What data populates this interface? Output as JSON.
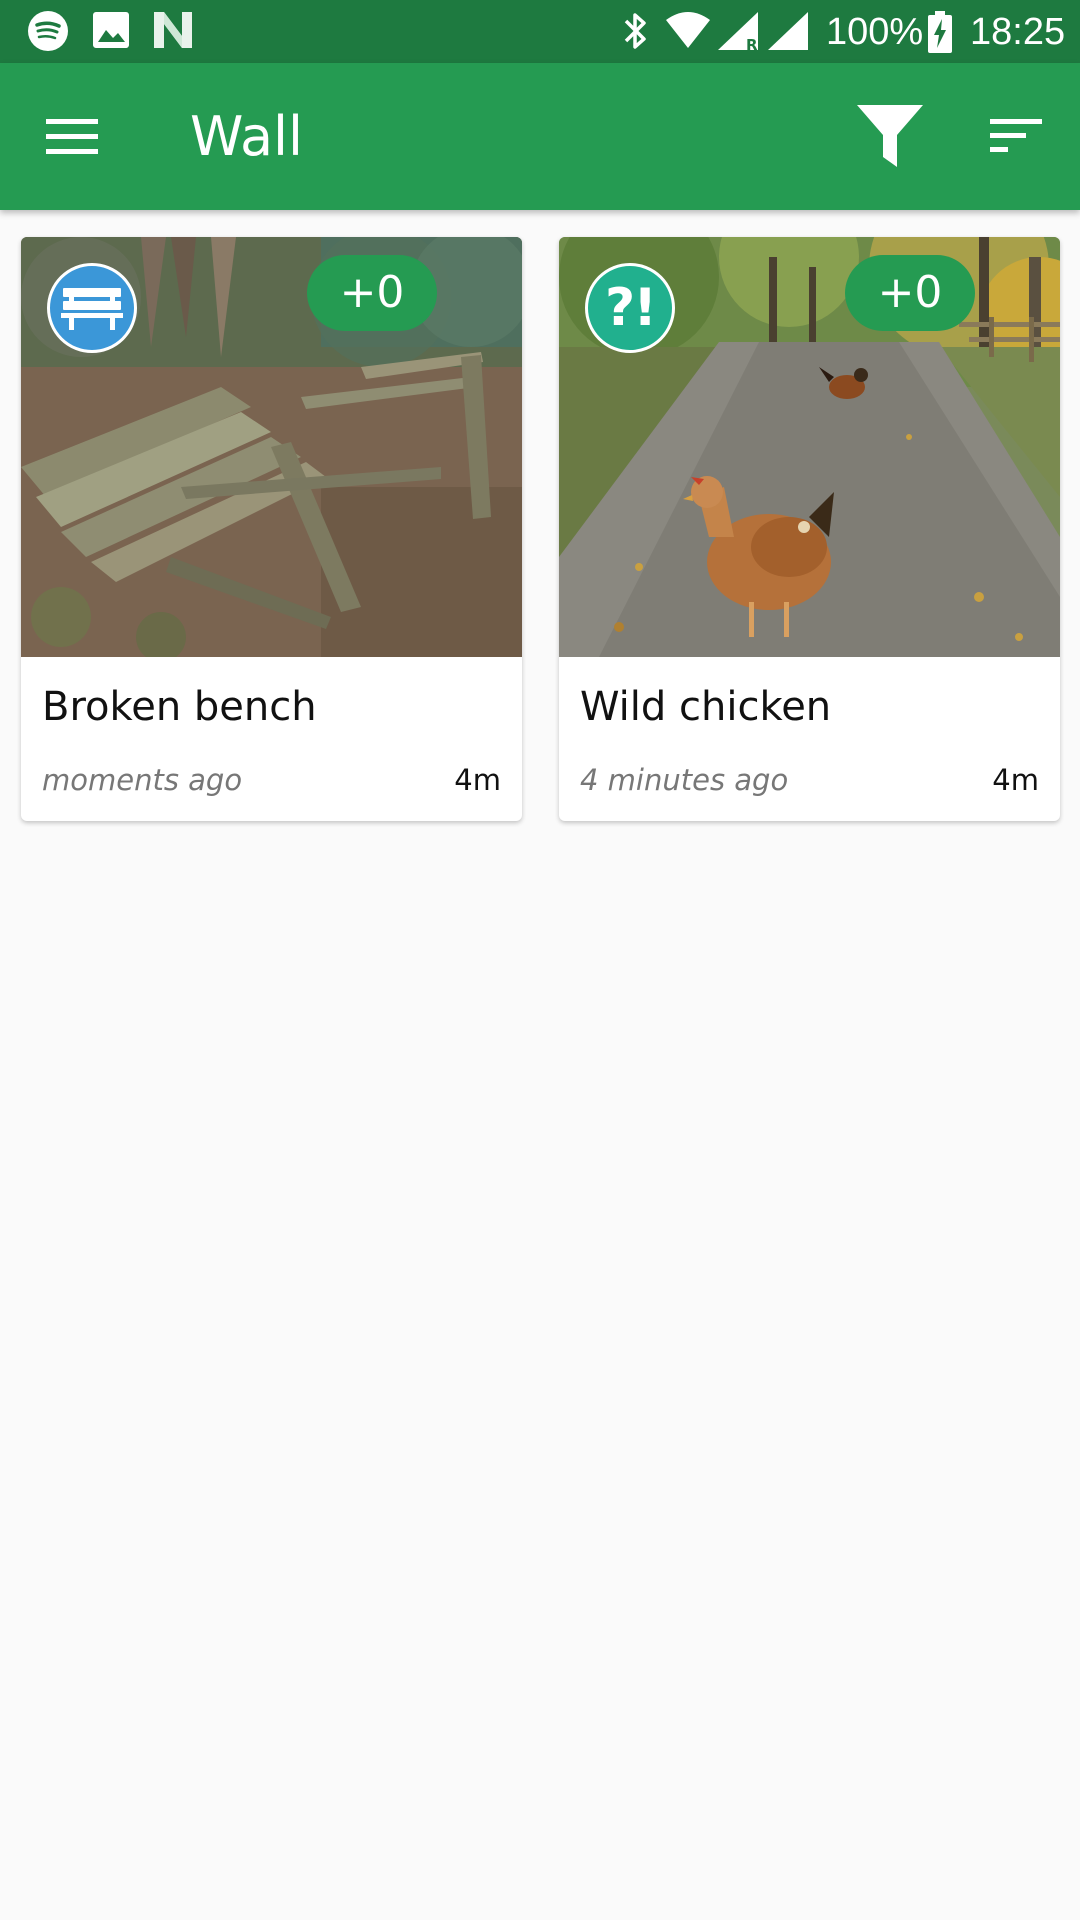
{
  "status_bar": {
    "battery": "100%",
    "time": "18:25",
    "icons": [
      "spotify-icon",
      "image-icon",
      "n-icon",
      "bluetooth-icon",
      "wifi-icon",
      "signal-r-icon",
      "signal-icon",
      "battery-charging-icon"
    ]
  },
  "app_bar": {
    "title": "Wall",
    "icons": [
      "menu-icon",
      "filter-icon",
      "sort-icon"
    ],
    "color": "#259b52",
    "status_color": "#1e7a40"
  },
  "cards": [
    {
      "title": "Broken bench",
      "time": "moments ago",
      "distance": "4m",
      "score": "+0",
      "category_icon": "bench-icon",
      "category_color": "#3b97d8"
    },
    {
      "title": "Wild chicken",
      "time": "4 minutes ago",
      "distance": "4m",
      "score": "+0",
      "category_icon": "question-exclamation-icon",
      "category_label": "?!",
      "category_color": "#21b08e"
    }
  ]
}
